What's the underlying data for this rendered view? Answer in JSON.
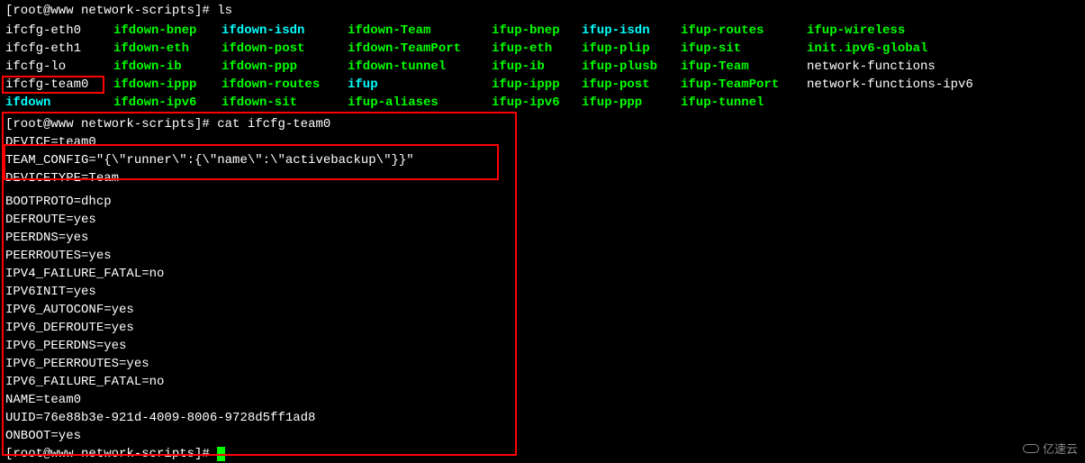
{
  "prompt1": "[root@www network-scripts]# ",
  "cmd1": "ls",
  "ls": {
    "col0": [
      "ifcfg-eth0",
      "ifcfg-eth1",
      "ifcfg-lo",
      "ifcfg-team0",
      "ifdown"
    ],
    "col1": [
      "ifdown-bnep",
      "ifdown-eth",
      "ifdown-ib",
      "ifdown-ippp",
      "ifdown-ipv6"
    ],
    "col2": [
      "ifdown-isdn",
      "ifdown-post",
      "ifdown-ppp",
      "ifdown-routes",
      "ifdown-sit"
    ],
    "col3": [
      "ifdown-Team",
      "ifdown-TeamPort",
      "ifdown-tunnel",
      "ifup",
      "ifup-aliases"
    ],
    "col4": [
      "ifup-bnep",
      "ifup-eth",
      "ifup-ib",
      "ifup-ippp",
      "ifup-ipv6"
    ],
    "col5": [
      "ifup-isdn",
      "ifup-plip",
      "ifup-plusb",
      "ifup-post",
      "ifup-ppp"
    ],
    "col6": [
      "ifup-routes",
      "ifup-sit",
      "ifup-Team",
      "ifup-TeamPort",
      "ifup-tunnel"
    ],
    "col7": [
      "ifup-wireless",
      "init.ipv6-global",
      "network-functions",
      "network-functions-ipv6",
      ""
    ]
  },
  "prompt2": "[root@www network-scripts]# ",
  "cmd2": "cat ifcfg-team0",
  "cat": [
    "DEVICE=team0",
    "TEAM_CONFIG=\"{\\\"runner\\\":{\\\"name\\\":\\\"activebackup\\\"}}\"",
    "DEVICETYPE=Team",
    "BOOTPROTO=dhcp",
    "DEFROUTE=yes",
    "PEERDNS=yes",
    "PEERROUTES=yes",
    "IPV4_FAILURE_FATAL=no",
    "IPV6INIT=yes",
    "IPV6_AUTOCONF=yes",
    "IPV6_DEFROUTE=yes",
    "IPV6_PEERDNS=yes",
    "IPV6_PEERROUTES=yes",
    "IPV6_FAILURE_FATAL=no",
    "NAME=team0",
    "UUID=76e88b3e-921d-4009-8006-9728d5ff1ad8",
    "ONBOOT=yes"
  ],
  "prompt3": "[root@www network-scripts]# ",
  "watermark": "亿速云"
}
